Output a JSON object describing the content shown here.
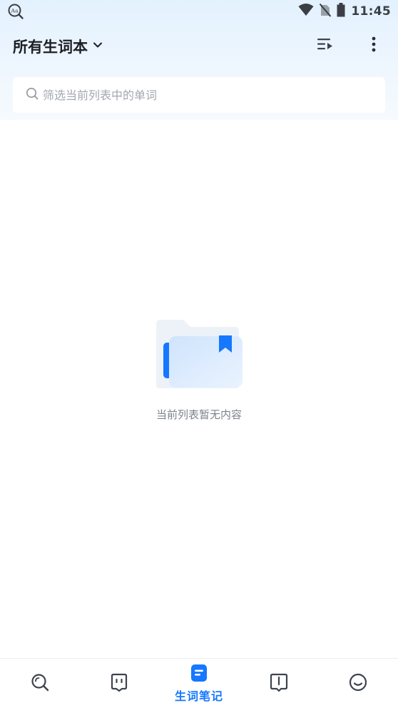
{
  "status_bar": {
    "time": "11:45",
    "app_icon": "dictionary-search-icon",
    "icons": [
      "wifi-icon",
      "no-sim-icon",
      "battery-icon"
    ]
  },
  "header": {
    "title": "所有生词本",
    "dropdown_icon": "chevron-down-icon",
    "actions": [
      "sort-play-icon",
      "more-vertical-icon"
    ]
  },
  "search": {
    "placeholder": "筛选当前列表中的单词",
    "value": ""
  },
  "empty_state": {
    "illustration": "empty-folder-bookmark-icon",
    "message": "当前列表暂无内容"
  },
  "bottom_nav": {
    "items": [
      {
        "icon": "search-icon",
        "label": "",
        "active": false
      },
      {
        "icon": "chat-icon",
        "label": "",
        "active": false
      },
      {
        "icon": "notebook-icon",
        "label": "生词笔记",
        "active": true
      },
      {
        "icon": "book-icon",
        "label": "",
        "active": false
      },
      {
        "icon": "smile-icon",
        "label": "",
        "active": false
      }
    ]
  },
  "colors": {
    "accent": "#1677ff",
    "icon_gray": "#3d4350",
    "header_bg": "#e3f1fe"
  }
}
